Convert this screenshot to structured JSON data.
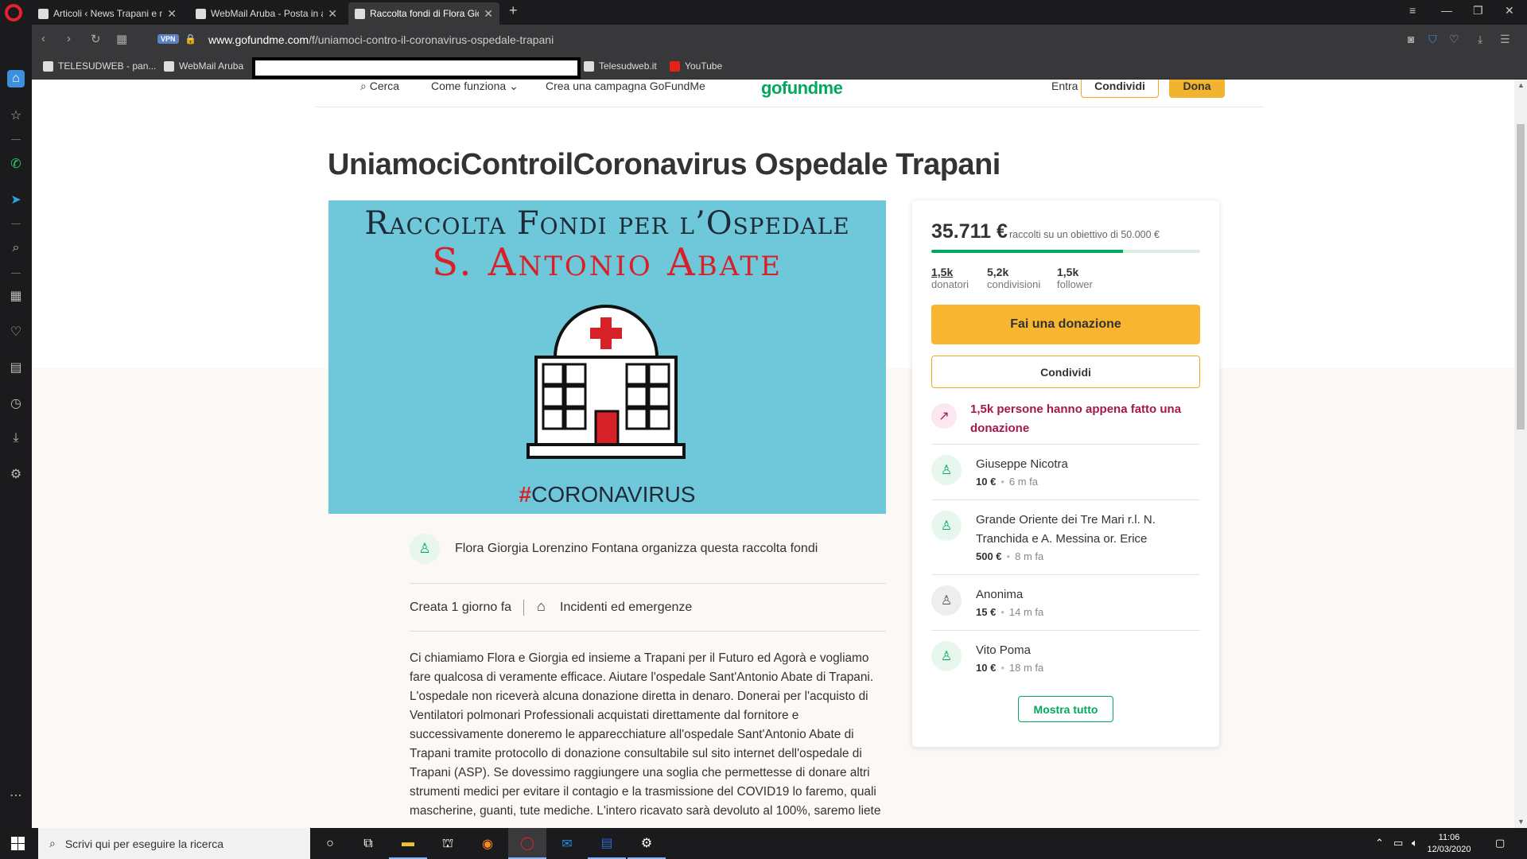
{
  "browser": {
    "tabs": [
      {
        "label": "Articoli ‹ News Trapani e no",
        "active": false
      },
      {
        "label": "WebMail Aruba - Posta in a",
        "active": false
      },
      {
        "label": "Raccolta fondi di Flora Gior",
        "active": true
      }
    ],
    "vpn_label": "VPN",
    "url_domain": "www.gofundme.com",
    "url_path": "/f/uniamoci-contro-il-coronavirus-ospedale-trapani",
    "bookmarks": [
      "TELESUDWEB - pan...",
      "WebMail Aruba",
      "Telesudweb.it",
      "YouTube"
    ]
  },
  "site_header": {
    "search": "Cerca",
    "how_it_works": "Come funziona",
    "create": "Crea una campagna GoFundMe",
    "logo": "gofundme",
    "login": "Entra",
    "share": "Condividi",
    "donate": "Dona"
  },
  "campaign": {
    "title": "UniamociControilCoronavirus Ospedale Trapani",
    "image_line1": "Raccolta Fondi per l’Ospedale",
    "image_line2": "S. Antonio Abate",
    "image_hash": "#",
    "image_tag": "CORONAVIRUS",
    "organizer": "Flora Giorgia Lorenzino Fontana organizza questa raccolta fondi",
    "created": "Creata 1 giorno fa",
    "category": "Incidenti ed emergenze",
    "story": "Ci chiamiamo Flora e Giorgia ed insieme a Trapani per il Futuro ed Agorà e vogliamo fare qualcosa di veramente efficace. Aiutare l'ospedale Sant'Antonio Abate di Trapani. L'ospedale non riceverà alcuna donazione diretta in denaro. Donerai per l'acquisto di Ventilatori polmonari Professionali acquistati direttamente dal fornitore e successivamente doneremo le apparecchiature all'ospedale Sant'Antonio Abate di Trapani tramite protocollo di donazione consultabile sul sito internet dell'ospedale di Trapani (ASP). Se dovessimo raggiungere una soglia che permettesse di donare altri strumenti medici per evitare il contagio e la trasmissione del COVID19 lo faremo, quali mascherine, guanti, tute mediche. L'intero ricavato sarà devoluto al 100%, saremo liete"
  },
  "donation_card": {
    "raised": "35.711 €",
    "goal_text": "raccolti su un obiettivo di 50.000 €",
    "progress_fraction": 0.714,
    "stats": [
      {
        "value": "1,5k",
        "label": "donatori"
      },
      {
        "value": "5,2k",
        "label": "condivisioni"
      },
      {
        "value": "1,5k",
        "label": "follower"
      }
    ],
    "donate_button": "Fai una donazione",
    "share_button": "Condividi",
    "trending": "1,5k persone hanno appena fatto una donazione",
    "donors": [
      {
        "name": "Giuseppe Nicotra",
        "amount": "10 €",
        "time": "6 m fa"
      },
      {
        "name": "Grande Oriente dei Tre Mari r.l. N. Tranchida e A. Messina or. Erice",
        "amount": "500 €",
        "time": "8 m fa"
      },
      {
        "name": "Anonima",
        "amount": "15 €",
        "time": "14 m fa"
      },
      {
        "name": "Vito Poma",
        "amount": "10 €",
        "time": "18 m fa"
      }
    ],
    "show_all": "Mostra tutto"
  },
  "taskbar": {
    "search_placeholder": "Scrivi qui per eseguire la ricerca",
    "time": "11:06",
    "date": "12/03/2020"
  },
  "colors": {
    "gofundme_green": "#02a95c",
    "donate_yellow": "#f8b630",
    "trending_purple": "#a4174f",
    "hero_blue": "#6fc8da"
  }
}
